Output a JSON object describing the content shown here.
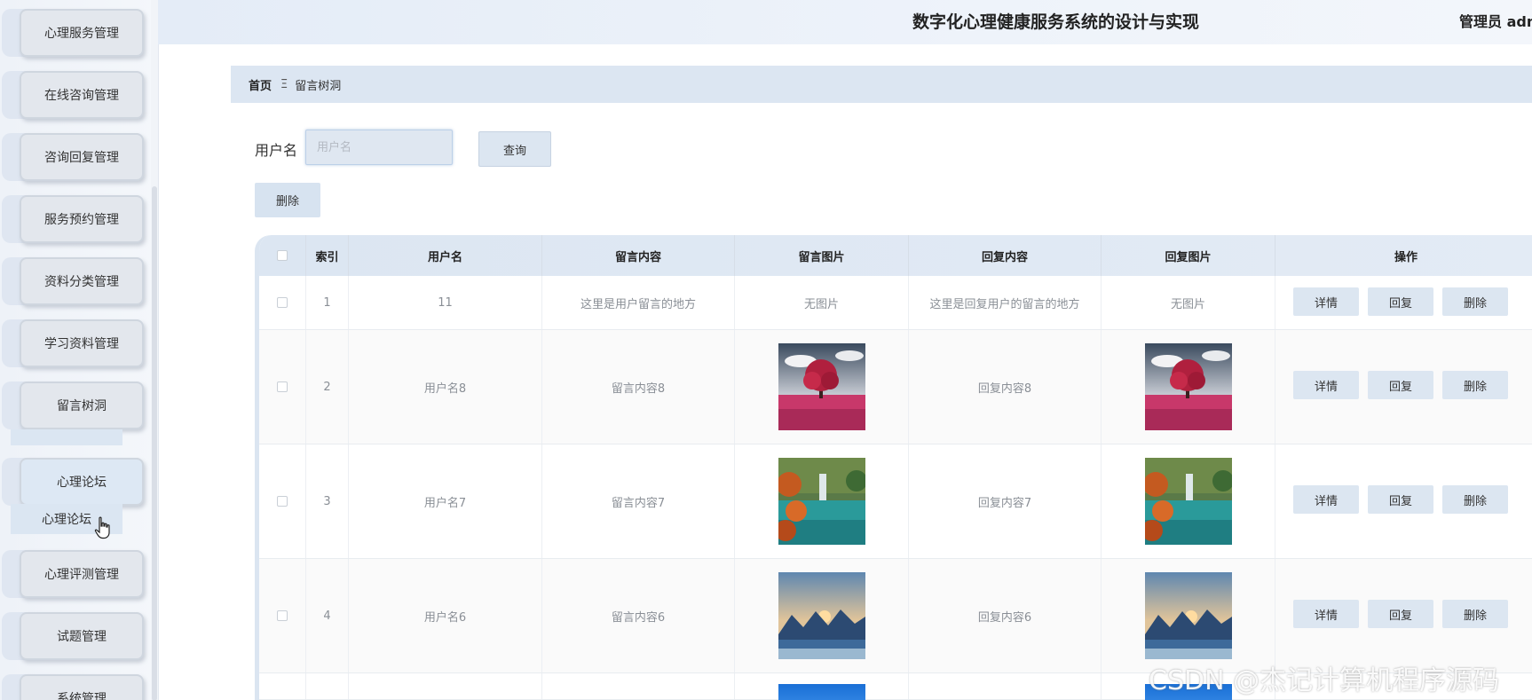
{
  "header": {
    "title": "数字化心理健康服务系统的设计与实现",
    "user": "管理员 adm"
  },
  "sidebar": {
    "items": [
      {
        "label": "心理服务管理"
      },
      {
        "label": "在线咨询管理"
      },
      {
        "label": "咨询回复管理"
      },
      {
        "label": "服务预约管理"
      },
      {
        "label": "资料分类管理"
      },
      {
        "label": "学习资料管理"
      },
      {
        "label": "留言树洞"
      },
      {
        "label": "心理论坛"
      },
      {
        "label": "心理评测管理"
      },
      {
        "label": "试题管理"
      },
      {
        "label": "系统管理"
      }
    ],
    "submenu": {
      "label": "心理论坛"
    }
  },
  "breadcrumb": {
    "home": "首页",
    "separator": "Ξ",
    "current": "留言树洞"
  },
  "search": {
    "label": "用户名",
    "placeholder": "用户名",
    "value": "",
    "query_label": "查询"
  },
  "toolbar": {
    "delete_label": "删除"
  },
  "table": {
    "columns": [
      "索引",
      "用户名",
      "留言内容",
      "留言图片",
      "回复内容",
      "回复图片",
      "操作"
    ],
    "rows": [
      {
        "index": "1",
        "username": "11",
        "message": "这里是用户留言的地方",
        "message_image": "无图片",
        "reply": "这里是回复用户的留言的地方",
        "reply_image": "无图片"
      },
      {
        "index": "2",
        "username": "用户名8",
        "message": "留言内容8",
        "message_image": "tree-photo",
        "reply": "回复内容8",
        "reply_image": "tree-photo"
      },
      {
        "index": "3",
        "username": "用户名7",
        "message": "留言内容7",
        "message_image": "lake-photo",
        "reply": "回复内容7",
        "reply_image": "lake-photo"
      },
      {
        "index": "4",
        "username": "用户名6",
        "message": "留言内容6",
        "message_image": "mountain-photo",
        "reply": "回复内容6",
        "reply_image": "mountain-photo"
      }
    ],
    "actions": {
      "detail": "详情",
      "reply": "回复",
      "delete": "删除"
    }
  },
  "watermark": "CSDN @杰记计算机程序源码",
  "colors": {
    "accent": "#dce6f1",
    "sidebar_button": "#e3e7ed",
    "header_bg": "#e4ecf7"
  }
}
